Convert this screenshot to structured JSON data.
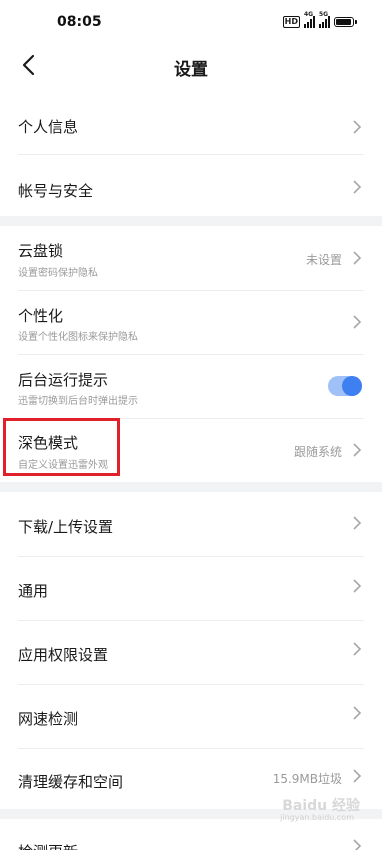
{
  "status_bar": {
    "time": "08:05",
    "hd": "HD",
    "net1": "4G",
    "net2": "5G"
  },
  "header": {
    "title": "设置"
  },
  "section1": [
    {
      "title": "个人信息"
    },
    {
      "title": "帐号与安全"
    }
  ],
  "section2": {
    "cloud_lock": {
      "title": "云盘锁",
      "subtitle": "设置密码保护隐私",
      "value": "未设置"
    },
    "personalize": {
      "title": "个性化",
      "subtitle": "设置个性化图标来保护隐私"
    },
    "background_tip": {
      "title": "后台运行提示",
      "subtitle": "迅雷切换到后台时弹出提示",
      "enabled": true
    },
    "dark_mode": {
      "title": "深色模式",
      "subtitle": "自定义设置迅雷外观",
      "value": "跟随系统"
    }
  },
  "section3": {
    "download_upload": {
      "title": "下载/上传设置"
    },
    "general": {
      "title": "通用"
    },
    "permissions": {
      "title": "应用权限设置"
    },
    "speed_test": {
      "title": "网速检测"
    },
    "clear_cache": {
      "title": "清理缓存和空间",
      "value": "15.9MB垃圾"
    }
  },
  "section4": {
    "check_update": {
      "title": "检测更新"
    }
  },
  "watermark": {
    "text": "Baidu 经验",
    "sub": "jingyan.baidu.com"
  },
  "colors": {
    "accent": "#3e7ff2",
    "highlight": "#e0202a",
    "section_gap": "#f2f3f5"
  }
}
